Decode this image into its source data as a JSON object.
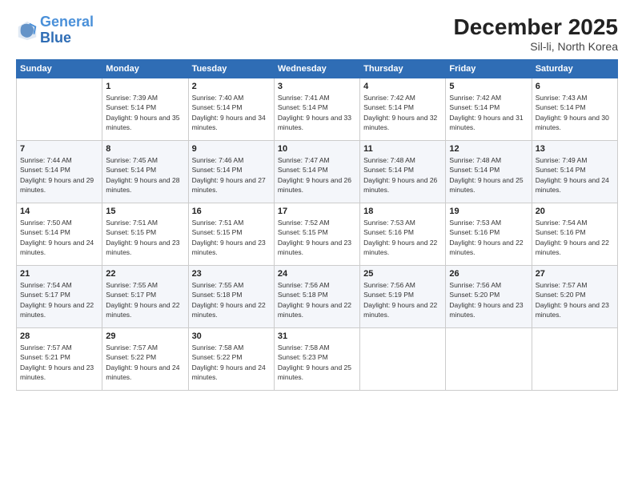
{
  "logo": {
    "line1": "General",
    "line2": "Blue"
  },
  "title": "December 2025",
  "subtitle": "Sil-li, North Korea",
  "days_header": [
    "Sunday",
    "Monday",
    "Tuesday",
    "Wednesday",
    "Thursday",
    "Friday",
    "Saturday"
  ],
  "weeks": [
    [
      {
        "day": "",
        "sunrise": "",
        "sunset": "",
        "daylight": ""
      },
      {
        "day": "1",
        "sunrise": "Sunrise: 7:39 AM",
        "sunset": "Sunset: 5:14 PM",
        "daylight": "Daylight: 9 hours and 35 minutes."
      },
      {
        "day": "2",
        "sunrise": "Sunrise: 7:40 AM",
        "sunset": "Sunset: 5:14 PM",
        "daylight": "Daylight: 9 hours and 34 minutes."
      },
      {
        "day": "3",
        "sunrise": "Sunrise: 7:41 AM",
        "sunset": "Sunset: 5:14 PM",
        "daylight": "Daylight: 9 hours and 33 minutes."
      },
      {
        "day": "4",
        "sunrise": "Sunrise: 7:42 AM",
        "sunset": "Sunset: 5:14 PM",
        "daylight": "Daylight: 9 hours and 32 minutes."
      },
      {
        "day": "5",
        "sunrise": "Sunrise: 7:42 AM",
        "sunset": "Sunset: 5:14 PM",
        "daylight": "Daylight: 9 hours and 31 minutes."
      },
      {
        "day": "6",
        "sunrise": "Sunrise: 7:43 AM",
        "sunset": "Sunset: 5:14 PM",
        "daylight": "Daylight: 9 hours and 30 minutes."
      }
    ],
    [
      {
        "day": "7",
        "sunrise": "Sunrise: 7:44 AM",
        "sunset": "Sunset: 5:14 PM",
        "daylight": "Daylight: 9 hours and 29 minutes."
      },
      {
        "day": "8",
        "sunrise": "Sunrise: 7:45 AM",
        "sunset": "Sunset: 5:14 PM",
        "daylight": "Daylight: 9 hours and 28 minutes."
      },
      {
        "day": "9",
        "sunrise": "Sunrise: 7:46 AM",
        "sunset": "Sunset: 5:14 PM",
        "daylight": "Daylight: 9 hours and 27 minutes."
      },
      {
        "day": "10",
        "sunrise": "Sunrise: 7:47 AM",
        "sunset": "Sunset: 5:14 PM",
        "daylight": "Daylight: 9 hours and 26 minutes."
      },
      {
        "day": "11",
        "sunrise": "Sunrise: 7:48 AM",
        "sunset": "Sunset: 5:14 PM",
        "daylight": "Daylight: 9 hours and 26 minutes."
      },
      {
        "day": "12",
        "sunrise": "Sunrise: 7:48 AM",
        "sunset": "Sunset: 5:14 PM",
        "daylight": "Daylight: 9 hours and 25 minutes."
      },
      {
        "day": "13",
        "sunrise": "Sunrise: 7:49 AM",
        "sunset": "Sunset: 5:14 PM",
        "daylight": "Daylight: 9 hours and 24 minutes."
      }
    ],
    [
      {
        "day": "14",
        "sunrise": "Sunrise: 7:50 AM",
        "sunset": "Sunset: 5:14 PM",
        "daylight": "Daylight: 9 hours and 24 minutes."
      },
      {
        "day": "15",
        "sunrise": "Sunrise: 7:51 AM",
        "sunset": "Sunset: 5:15 PM",
        "daylight": "Daylight: 9 hours and 23 minutes."
      },
      {
        "day": "16",
        "sunrise": "Sunrise: 7:51 AM",
        "sunset": "Sunset: 5:15 PM",
        "daylight": "Daylight: 9 hours and 23 minutes."
      },
      {
        "day": "17",
        "sunrise": "Sunrise: 7:52 AM",
        "sunset": "Sunset: 5:15 PM",
        "daylight": "Daylight: 9 hours and 23 minutes."
      },
      {
        "day": "18",
        "sunrise": "Sunrise: 7:53 AM",
        "sunset": "Sunset: 5:16 PM",
        "daylight": "Daylight: 9 hours and 22 minutes."
      },
      {
        "day": "19",
        "sunrise": "Sunrise: 7:53 AM",
        "sunset": "Sunset: 5:16 PM",
        "daylight": "Daylight: 9 hours and 22 minutes."
      },
      {
        "day": "20",
        "sunrise": "Sunrise: 7:54 AM",
        "sunset": "Sunset: 5:16 PM",
        "daylight": "Daylight: 9 hours and 22 minutes."
      }
    ],
    [
      {
        "day": "21",
        "sunrise": "Sunrise: 7:54 AM",
        "sunset": "Sunset: 5:17 PM",
        "daylight": "Daylight: 9 hours and 22 minutes."
      },
      {
        "day": "22",
        "sunrise": "Sunrise: 7:55 AM",
        "sunset": "Sunset: 5:17 PM",
        "daylight": "Daylight: 9 hours and 22 minutes."
      },
      {
        "day": "23",
        "sunrise": "Sunrise: 7:55 AM",
        "sunset": "Sunset: 5:18 PM",
        "daylight": "Daylight: 9 hours and 22 minutes."
      },
      {
        "day": "24",
        "sunrise": "Sunrise: 7:56 AM",
        "sunset": "Sunset: 5:18 PM",
        "daylight": "Daylight: 9 hours and 22 minutes."
      },
      {
        "day": "25",
        "sunrise": "Sunrise: 7:56 AM",
        "sunset": "Sunset: 5:19 PM",
        "daylight": "Daylight: 9 hours and 22 minutes."
      },
      {
        "day": "26",
        "sunrise": "Sunrise: 7:56 AM",
        "sunset": "Sunset: 5:20 PM",
        "daylight": "Daylight: 9 hours and 23 minutes."
      },
      {
        "day": "27",
        "sunrise": "Sunrise: 7:57 AM",
        "sunset": "Sunset: 5:20 PM",
        "daylight": "Daylight: 9 hours and 23 minutes."
      }
    ],
    [
      {
        "day": "28",
        "sunrise": "Sunrise: 7:57 AM",
        "sunset": "Sunset: 5:21 PM",
        "daylight": "Daylight: 9 hours and 23 minutes."
      },
      {
        "day": "29",
        "sunrise": "Sunrise: 7:57 AM",
        "sunset": "Sunset: 5:22 PM",
        "daylight": "Daylight: 9 hours and 24 minutes."
      },
      {
        "day": "30",
        "sunrise": "Sunrise: 7:58 AM",
        "sunset": "Sunset: 5:22 PM",
        "daylight": "Daylight: 9 hours and 24 minutes."
      },
      {
        "day": "31",
        "sunrise": "Sunrise: 7:58 AM",
        "sunset": "Sunset: 5:23 PM",
        "daylight": "Daylight: 9 hours and 25 minutes."
      },
      {
        "day": "",
        "sunrise": "",
        "sunset": "",
        "daylight": ""
      },
      {
        "day": "",
        "sunrise": "",
        "sunset": "",
        "daylight": ""
      },
      {
        "day": "",
        "sunrise": "",
        "sunset": "",
        "daylight": ""
      }
    ]
  ]
}
